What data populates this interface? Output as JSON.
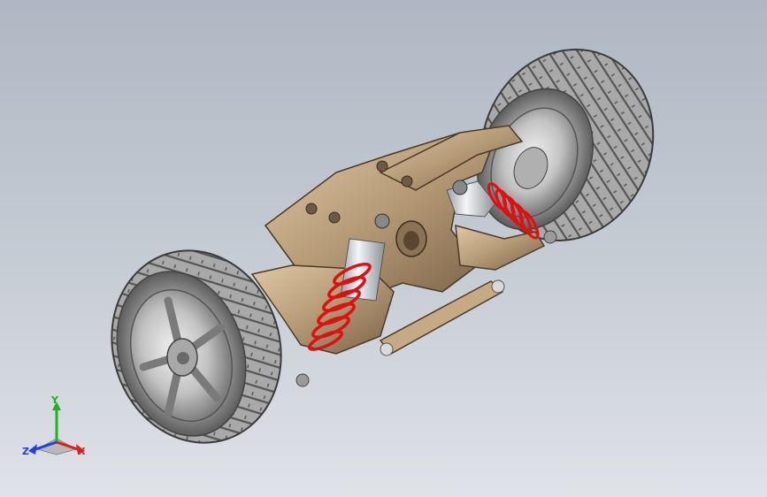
{
  "viewport": {
    "background_top": "#aeb7c3",
    "background_bottom": "#dfe2e7"
  },
  "model": {
    "tire_color": "#8d8d8d",
    "rim_color": "#c8c8c8",
    "chassis_color": "#b59a76",
    "spring_color": "#e01010",
    "shock_body_color": "#d9dde3"
  },
  "triad": {
    "x_label": "X",
    "y_label": "Y",
    "z_label": "Z",
    "x_color": "#e02020",
    "y_color": "#20b020",
    "z_color": "#2040e0"
  }
}
